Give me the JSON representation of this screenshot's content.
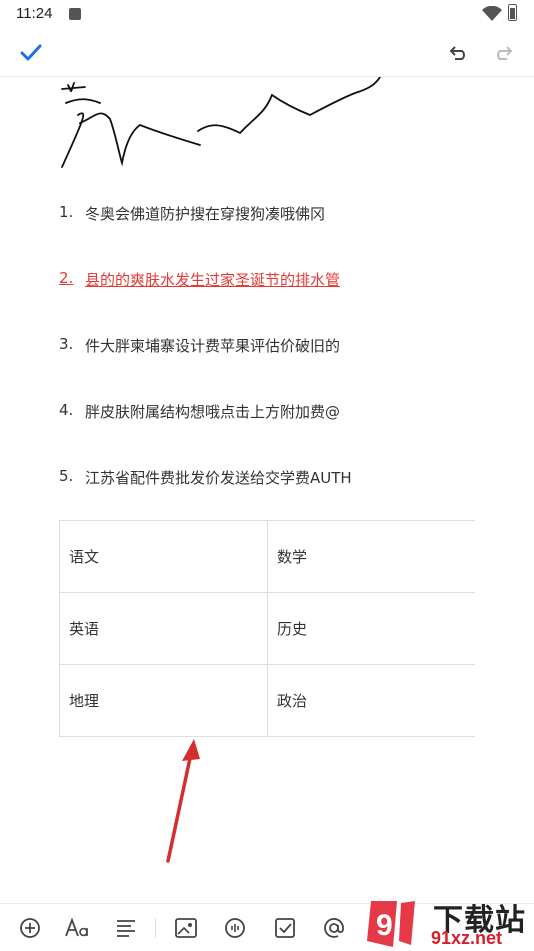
{
  "status_bar": {
    "time": "11:24"
  },
  "list_items": [
    {
      "num": "1.",
      "text": "冬奥会佛道防护搜在穿搜狗凑哦佛冈"
    },
    {
      "num": "2.",
      "text": "县的的爽肤水发生过家圣诞节的排水管"
    },
    {
      "num": "3.",
      "text": "件大胖柬埔寨设计费苹果评估价破旧的"
    },
    {
      "num": "4.",
      "text": "胖皮肤附属结构想哦点击上方附加费@"
    },
    {
      "num": "5.",
      "text": "江苏省配件费批发价发送给交学费AUTH"
    }
  ],
  "table": [
    [
      "语文",
      "数学"
    ],
    [
      "英语",
      "历史"
    ],
    [
      "地理",
      "政治"
    ]
  ],
  "watermark": {
    "line1": "下载站",
    "line2": "91xz.net",
    "logo": "9"
  },
  "colors": {
    "accent": "#1a73e8",
    "red": "#e53935",
    "arrow": "#d32f2f"
  }
}
